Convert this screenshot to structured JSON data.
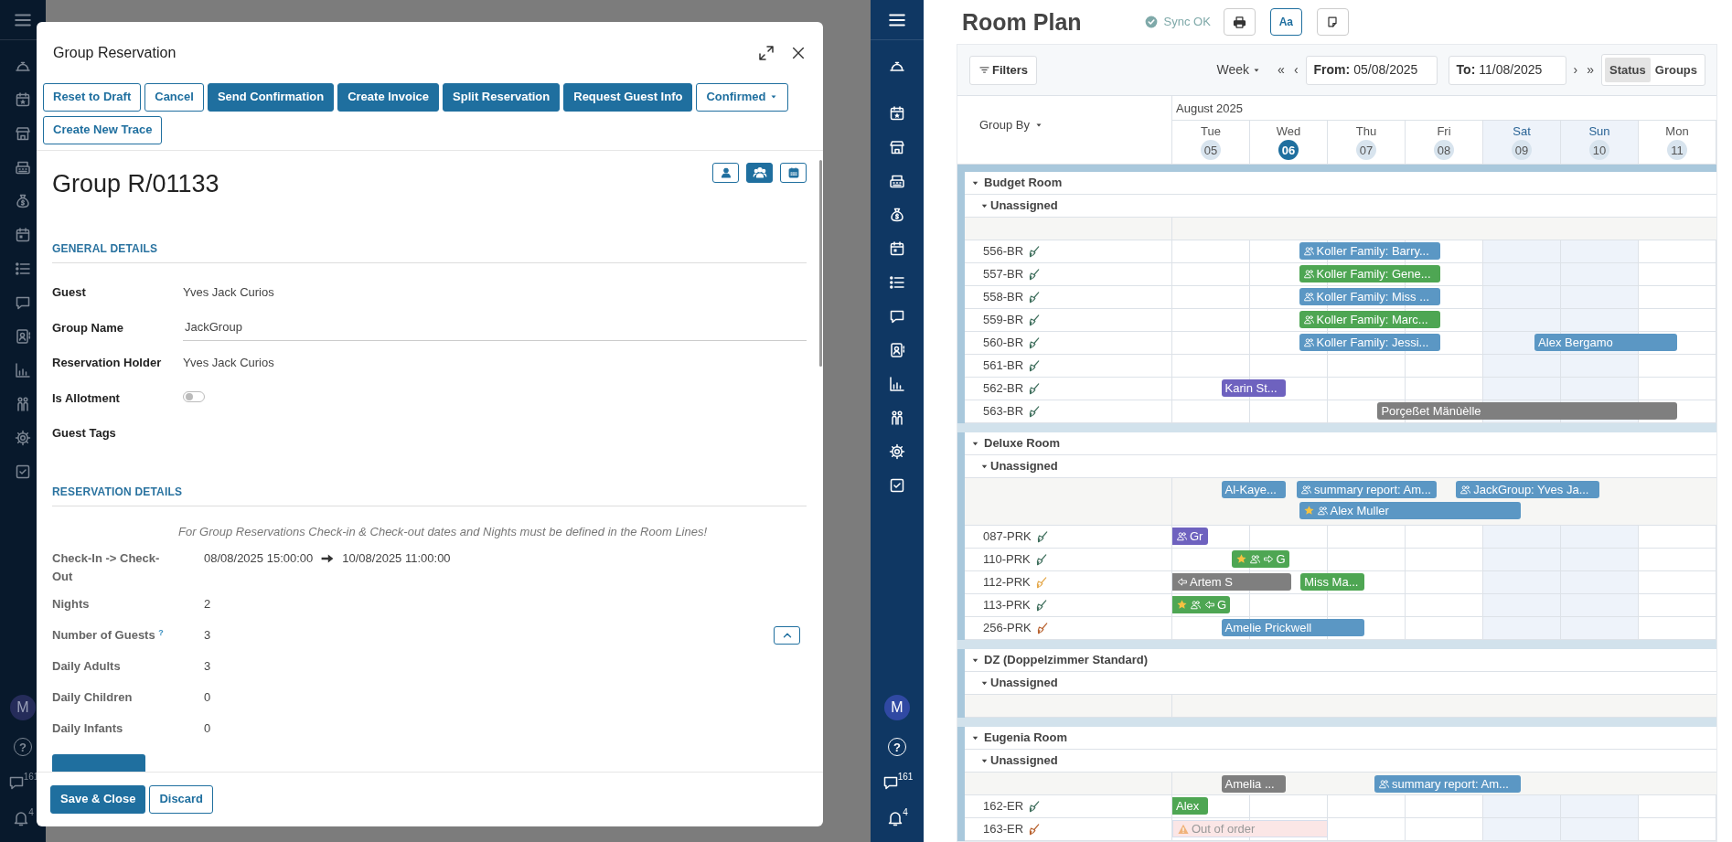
{
  "left_app": {
    "sidebar": {
      "avatar": "M",
      "help": "?",
      "messages_count": "161",
      "notifications_count": "4"
    }
  },
  "dialog": {
    "title": "Group Reservation",
    "actions": [
      [
        {
          "label": "Reset to Draft",
          "primary": false
        },
        {
          "label": "Cancel",
          "primary": false
        },
        {
          "label": "Send Confirmation",
          "primary": true
        },
        {
          "label": "Create Invoice",
          "primary": true
        },
        {
          "label": "Split Reservation",
          "primary": true
        },
        {
          "label": "Request Guest Info",
          "primary": true
        },
        {
          "label": "Confirmed",
          "primary": false,
          "dropdown": true
        }
      ],
      [
        {
          "label": "Create New Trace",
          "primary": false
        }
      ]
    ],
    "record_title": "Group R/01133",
    "view_buttons": [
      {
        "kind": "person",
        "selected": false
      },
      {
        "kind": "group",
        "selected": true
      },
      {
        "kind": "calendar",
        "selected": false
      }
    ],
    "sections": [
      {
        "title": "GENERAL DETAILS",
        "fields": [
          {
            "label": "Guest",
            "kind": "text",
            "value": "Yves Jack Curios"
          },
          {
            "label": "Group Name",
            "kind": "input",
            "value": "JackGroup"
          },
          {
            "label": "Reservation Holder",
            "kind": "text",
            "value": "Yves Jack Curios"
          },
          {
            "label": "Is Allotment",
            "kind": "toggle",
            "on": false
          },
          {
            "label": "Guest Tags",
            "kind": "tags"
          }
        ]
      },
      {
        "title": "RESERVATION DETAILS",
        "note": "For Group Reservations Check-in & Check-out dates and Nights must be defined in the Room Lines!",
        "fields": [
          {
            "label": "Check-In -> Check-Out",
            "kind": "range",
            "value": "08/08/2025 15:00:00",
            "value_end": "10/08/2025 11:00:00"
          },
          {
            "label": "Nights",
            "kind": "text",
            "value": "2"
          },
          {
            "label": "Number of Guests $^{?}$",
            "kind": "text",
            "value": "3",
            "expanded": true
          },
          {
            "label": "Daily Adults",
            "kind": "text",
            "value": "3"
          },
          {
            "label": "Daily Children",
            "kind": "text",
            "value": "0"
          },
          {
            "label": "Daily Infants",
            "kind": "text",
            "value": "0"
          }
        ]
      }
    ],
    "footer": [
      {
        "label": "Save & Close",
        "primary": true
      },
      {
        "label": "Discard",
        "primary": false
      }
    ]
  },
  "right_app": {
    "sidebar": {
      "avatar": "M",
      "help": "?",
      "messages_count": "161",
      "notifications_count": "4"
    }
  },
  "room_plan": {
    "title": "Room Plan",
    "sync": "Sync OK",
    "tools": [
      {
        "kind": "print",
        "active": false
      },
      {
        "kind": "text",
        "label": "Aa",
        "active": true
      },
      {
        "kind": "note",
        "active": false
      }
    ],
    "filters": "Filters",
    "period": "Week",
    "nav_back": [
      "«",
      "‹"
    ],
    "from_label": "From:",
    "from": "05/08/2025",
    "to_label": "To:",
    "to": "11/08/2025",
    "nav_forward": [
      "›",
      "»"
    ],
    "view_modes": [
      {
        "label": "Status",
        "selected": true
      },
      {
        "label": "Groups",
        "selected": false
      }
    ],
    "group_by": "Group By",
    "month": "August 2025",
    "days": [
      {
        "name": "Tue",
        "date": "05",
        "today": false,
        "weekend": false
      },
      {
        "name": "Wed",
        "date": "06",
        "today": true,
        "weekend": false
      },
      {
        "name": "Thu",
        "date": "07",
        "today": false,
        "weekend": false
      },
      {
        "name": "Fri",
        "date": "08",
        "today": false,
        "weekend": false
      },
      {
        "name": "Sat",
        "date": "09",
        "today": false,
        "weekend": true
      },
      {
        "name": "Sun",
        "date": "10",
        "today": false,
        "weekend": true
      },
      {
        "name": "Mon",
        "date": "11",
        "today": false,
        "weekend": false
      }
    ],
    "groups": [
      {
        "name": "Budget Room",
        "expanded": true,
        "unassigned": {
          "label": "Unassigned",
          "expanded": true
        },
        "rooms": [
          {
            "name": "556-BR",
            "color": "#3e6e5c",
            "bookings": [
              {
                "label": "Koller Family: Barry...",
                "kind": "booking",
                "color": "#5b97c4",
                "group": true,
                "starred": false
              }
            ]
          },
          {
            "name": "557-BR",
            "color": "#3e6e5c",
            "bookings": [
              {
                "label": "Koller Family: Gene...",
                "kind": "booking",
                "color": "#4ea653",
                "group": true,
                "starred": false
              }
            ]
          },
          {
            "name": "558-BR",
            "color": "#3e6e5c",
            "bookings": [
              {
                "label": "Koller Family: Miss ...",
                "kind": "booking",
                "color": "#5b97c4",
                "group": true,
                "starred": false
              }
            ]
          },
          {
            "name": "559-BR",
            "color": "#3e6e5c",
            "bookings": [
              {
                "label": "Koller Family: Marc...",
                "kind": "booking",
                "color": "#4ea653",
                "group": true,
                "starred": false
              }
            ]
          },
          {
            "name": "560-BR",
            "color": "#3e6e5c",
            "bookings": [
              {
                "label": "Koller Family: Jessi...",
                "kind": "booking",
                "color": "#5b97c4",
                "group": true,
                "starred": false
              },
              {
                "label": "Alex Bergamo",
                "kind": "booking",
                "color": "#5b97c4",
                "group": false,
                "starred": false
              }
            ]
          },
          {
            "name": "561-BR",
            "color": "#3e6e5c"
          },
          {
            "name": "562-BR",
            "color": "#3e6e5c",
            "bookings": [
              {
                "label": "Karin St...",
                "kind": "booking",
                "color": "#6e62bf",
                "group": false,
                "starred": false
              }
            ]
          },
          {
            "name": "563-BR",
            "color": "#3e6e5c",
            "bookings": [
              {
                "label": "Porçeßet Mänùèlle",
                "kind": "booking",
                "color": "#7f7f7f",
                "group": false,
                "starred": false
              }
            ]
          }
        ]
      },
      {
        "name": "Deluxe Room",
        "expanded": true,
        "unassigned": {
          "label": "Unassigned",
          "expanded": true,
          "lanes": [
            [
              {
                "label": "Al-Kaye...",
                "kind": "booking",
                "color": "#5b97c4",
                "group": false,
                "starred": false
              },
              {
                "label": "summary report: Am...",
                "kind": "booking",
                "color": "#5b97c4",
                "group": true,
                "starred": false
              },
              {
                "label": "JackGroup: Yves Ja...",
                "kind": "booking",
                "color": "#5b97c4",
                "group": true,
                "starred": false
              }
            ],
            [
              {
                "label": "Alex Muller",
                "kind": "booking",
                "color": "#5b97c4",
                "group": true,
                "starred": true
              }
            ]
          ]
        },
        "rooms": [
          {
            "name": "087-PRK",
            "color": "#3e6e5c",
            "bookings": [
              {
                "label": "Gr",
                "kind": "booking",
                "color": "#6e62bf",
                "group": true,
                "starred": false
              }
            ]
          },
          {
            "name": "110-PRK",
            "color": "#3e6e5c",
            "bookings": [
              {
                "label": "G",
                "kind": "booking",
                "color": "#4ea653",
                "group": true,
                "starred": true,
                "arrow_right": true
              }
            ]
          },
          {
            "name": "112-PRK",
            "color": "#e4a84a",
            "bookings": [
              {
                "label": "Artem S",
                "kind": "booking",
                "color": "#7f7f7f",
                "group": false,
                "starred": false,
                "arrow_left": true
              },
              {
                "label": "Miss Ma...",
                "kind": "booking",
                "color": "#4ea653",
                "group": false,
                "starred": false
              }
            ]
          },
          {
            "name": "113-PRK",
            "color": "#3e6e5c",
            "bookings": [
              {
                "label": "G",
                "kind": "booking",
                "color": "#4ea653",
                "group": true,
                "starred": true,
                "arrow_left": true
              }
            ]
          },
          {
            "name": "256-PRK",
            "color": "#b8612e",
            "bookings": [
              {
                "label": "Amelie Prickwell",
                "kind": "booking",
                "color": "#5b97c4",
                "group": false,
                "starred": false
              }
            ]
          }
        ]
      },
      {
        "name": "DZ (Doppelzimmer Standard)",
        "expanded": true,
        "unassigned": {
          "label": "Unassigned",
          "expanded": true
        }
      },
      {
        "name": "Eugenia Room",
        "expanded": true,
        "unassigned": {
          "label": "Unassigned",
          "expanded": true,
          "lanes": [
            [
              {
                "label": "Amelia ...",
                "kind": "booking",
                "color": "#7f7f7f",
                "group": false,
                "starred": false
              },
              {
                "label": "summary report: Am...",
                "kind": "booking",
                "color": "#5b97c4",
                "group": true,
                "starred": false
              }
            ]
          ]
        },
        "rooms": [
          {
            "name": "162-ER",
            "color": "#3e6e5c",
            "bookings": [
              {
                "label": "Alex",
                "kind": "booking",
                "color": "#4ea653",
                "group": false,
                "starred": false
              }
            ]
          },
          {
            "name": "163-ER",
            "color": "#b8612e",
            "bookings": [
              {
                "label": "Out of order",
                "kind": "blocked"
              }
            ]
          }
        ]
      }
    ]
  }
}
